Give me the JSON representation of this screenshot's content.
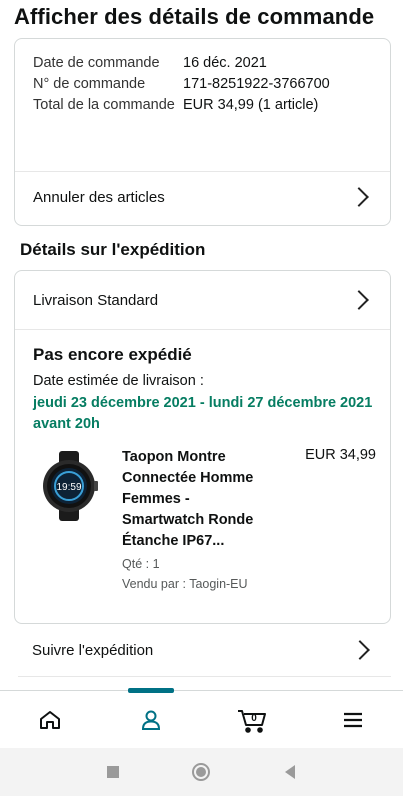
{
  "page": {
    "title": "Afficher des détails de commande"
  },
  "summary": {
    "order_date_label": "Date de commande",
    "order_date": "16 déc. 2021",
    "order_number_label": "N° de commande",
    "order_number": "171-8251922-3766700",
    "total_label": "Total de la commande",
    "total": "EUR 34,99 (1 article)",
    "cancel_label": "Annuler des articles"
  },
  "shipping": {
    "section_title": "Détails sur l'expédition",
    "method": "Livraison Standard",
    "status": "Pas encore expédié",
    "estimated_label": "Date estimée de livraison :",
    "estimated_date": "jeudi 23 décembre 2021 - lundi 27 décembre 2021 avant 20h"
  },
  "product": {
    "name": "Taopon Montre Connectée Homme Femmes - Smartwatch Ronde Étanche IP67...",
    "price": "EUR 34,99",
    "qty": "Qté : 1",
    "seller": "Vendu par : Taogin-EU",
    "watch_time": "19:59"
  },
  "track": {
    "label": "Suivre l'expédition"
  },
  "nav": {
    "active_index": 1,
    "items": [
      "home-icon",
      "account-icon",
      "cart-icon",
      "menu-icon"
    ],
    "cart_count": "0",
    "accent": "#007185"
  },
  "colors": {
    "delivery_green": "#067d62",
    "border": "#d5d9d9"
  }
}
